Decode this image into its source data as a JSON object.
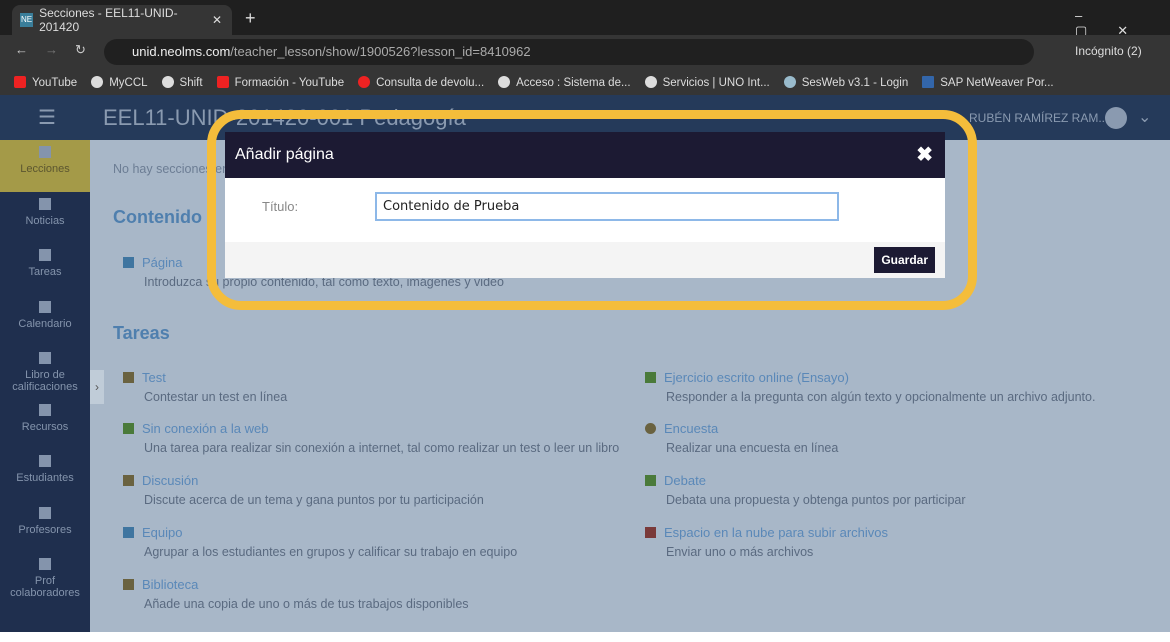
{
  "browser": {
    "tab_title": "Secciones - EEL11-UNID-201420",
    "tab_favicon": "NE",
    "url_host": "unid.neolms.com",
    "url_path": "/teacher_lesson/show/1900526?lesson_id=8410962",
    "profile": "Incógnito (2)",
    "bookmarks": [
      "YouTube",
      "MyCCL",
      "Shift",
      "Formación - YouTube",
      "Consulta de devolu...",
      "Acceso : Sistema de...",
      "Servicios | UNO Int...",
      "SesWeb v3.1 - Login",
      "SAP NetWeaver Por..."
    ]
  },
  "header": {
    "course_title": "EEL11-UNID-201420-001 Pedagogía",
    "user": "RUBÉN RAMÍREZ RAM..."
  },
  "sidebar": [
    "Lecciones",
    "Noticias",
    "Tareas",
    "Calendario",
    "Libro de calificaciones",
    "Recursos",
    "Estudiantes",
    "Profesores",
    "Prof colaboradores"
  ],
  "main": {
    "no_sections": "No hay secciones en esta lección",
    "contenido_heading": "Contenido",
    "tareas_heading": "Tareas",
    "pagina": {
      "title": "Página",
      "desc": "Introduzca su propio contenido, tal como texto, imágenes y video"
    },
    "tasks": [
      {
        "title": "Test",
        "desc": "Contestar un test en línea"
      },
      {
        "title": "Ejercicio escrito online (Ensayo)",
        "desc": "Responder a la pregunta con algún texto y opcionalmente un archivo adjunto."
      },
      {
        "title": "Sin conexión a la web",
        "desc": "Una tarea para realizar sin conexión a internet, tal como realizar un test o leer un libro"
      },
      {
        "title": "Encuesta",
        "desc": "Realizar una encuesta en línea"
      },
      {
        "title": "Discusión",
        "desc": "Discute acerca de un tema y gana puntos por tu participación"
      },
      {
        "title": "Debate",
        "desc": "Debata una propuesta y obtenga puntos por participar"
      },
      {
        "title": "Equipo",
        "desc": "Agrupar a los estudiantes en grupos y calificar su trabajo en equipo"
      },
      {
        "title": "Espacio en la nube para subir archivos",
        "desc": "Enviar uno o más archivos"
      },
      {
        "title": "Biblioteca",
        "desc": "Añade una copia de uno o más de tus trabajos disponibles"
      }
    ]
  },
  "modal": {
    "title": "Añadir página",
    "label": "Título:",
    "value": "Contenido de Prueba",
    "save": "Guardar",
    "close": "✖"
  },
  "colors": {
    "highlight": "#f4bd3b",
    "modal_header": "#1c1a33",
    "active_nav": "#a49a48"
  }
}
